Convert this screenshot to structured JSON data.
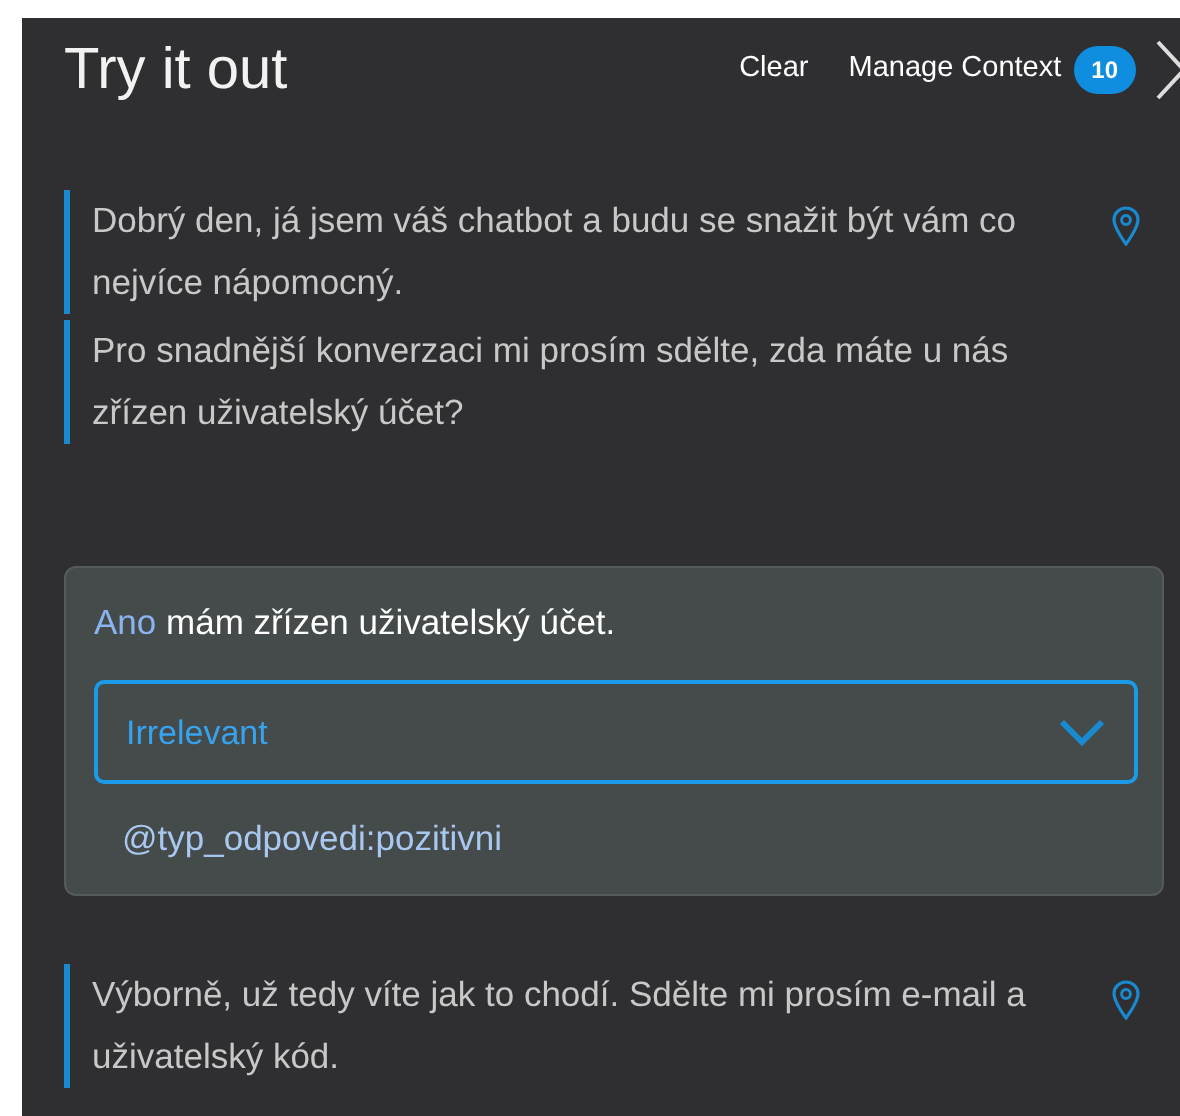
{
  "header": {
    "title": "Try it out",
    "clear": "Clear",
    "manage_context": "Manage Context",
    "context_count": "10"
  },
  "messages": [
    {
      "kind": "bot",
      "paragraphs": [
        "Dobrý den, já jsem váš chatbot a budu se snažit být vám co nejvíce nápomocný.",
        "Pro snadnější konverzaci mi prosím sdělte, zda máte u nás zřízen uživatelský účet?"
      ]
    },
    {
      "kind": "user",
      "text_parts": [
        {
          "text": "Ano",
          "highlighted": true
        },
        {
          "text": " mám zřízen uživatelský účet.",
          "highlighted": false
        }
      ],
      "intent": "Irrelevant",
      "entity": "@typ_odpovedi:pozitivni"
    },
    {
      "kind": "bot",
      "paragraphs": [
        "Výborně, už tedy víte jak to chodí. Sdělte mi prosím e-mail a uživatelský kód."
      ]
    }
  ]
}
